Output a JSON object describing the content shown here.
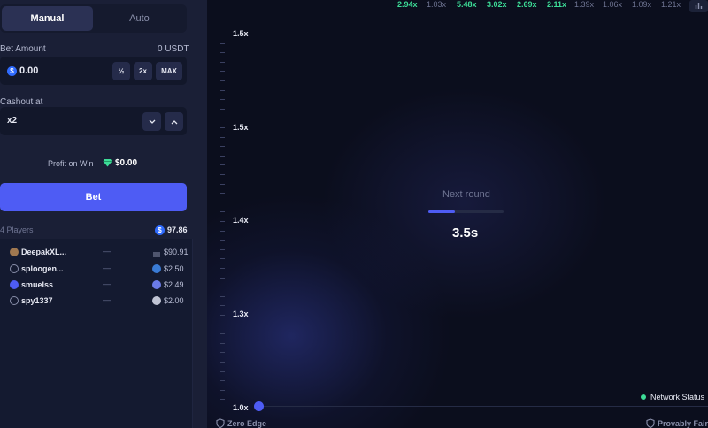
{
  "tabs": {
    "manual": "Manual",
    "auto": "Auto"
  },
  "bet": {
    "label": "Bet Amount",
    "balance": "0 USDT",
    "currency_icon": "$",
    "value": "0.00",
    "half": "½",
    "double": "2x",
    "max": "MAX"
  },
  "cashout": {
    "label": "Cashout at",
    "value": "x2"
  },
  "profit": {
    "label": "Profit on Win",
    "value": "$0.00"
  },
  "bet_button": "Bet",
  "players": {
    "count_label": "4 Players",
    "total_icon": "$",
    "total": "97.86",
    "list": [
      {
        "name": "DeepakXL...",
        "dash": "—",
        "amount": "$90.91"
      },
      {
        "name": "sploogen...",
        "dash": "—",
        "amount": "$2.50"
      },
      {
        "name": "smuelss",
        "dash": "—",
        "amount": "$2.49"
      },
      {
        "name": "spy1337",
        "dash": "—",
        "amount": "$2.00"
      }
    ]
  },
  "history": [
    "2.94x",
    "1.03x",
    "5.48x",
    "3.02x",
    "2.69x",
    "2.11x",
    "1.39x",
    "1.06x",
    "1.09x",
    "1.21x"
  ],
  "y_axis": [
    "1.5x",
    "1.5x",
    "1.4x",
    "1.3x",
    "1.0x"
  ],
  "round": {
    "label": "Next round",
    "countdown": "3.5s",
    "progress": 0.35
  },
  "footer": {
    "left": "Zero Edge",
    "network": "Network Status",
    "fair": "Provably Fair"
  },
  "colors": {
    "accent": "#4e5cf4",
    "green": "#3ddc97",
    "status_dot": "#3ddc97"
  }
}
